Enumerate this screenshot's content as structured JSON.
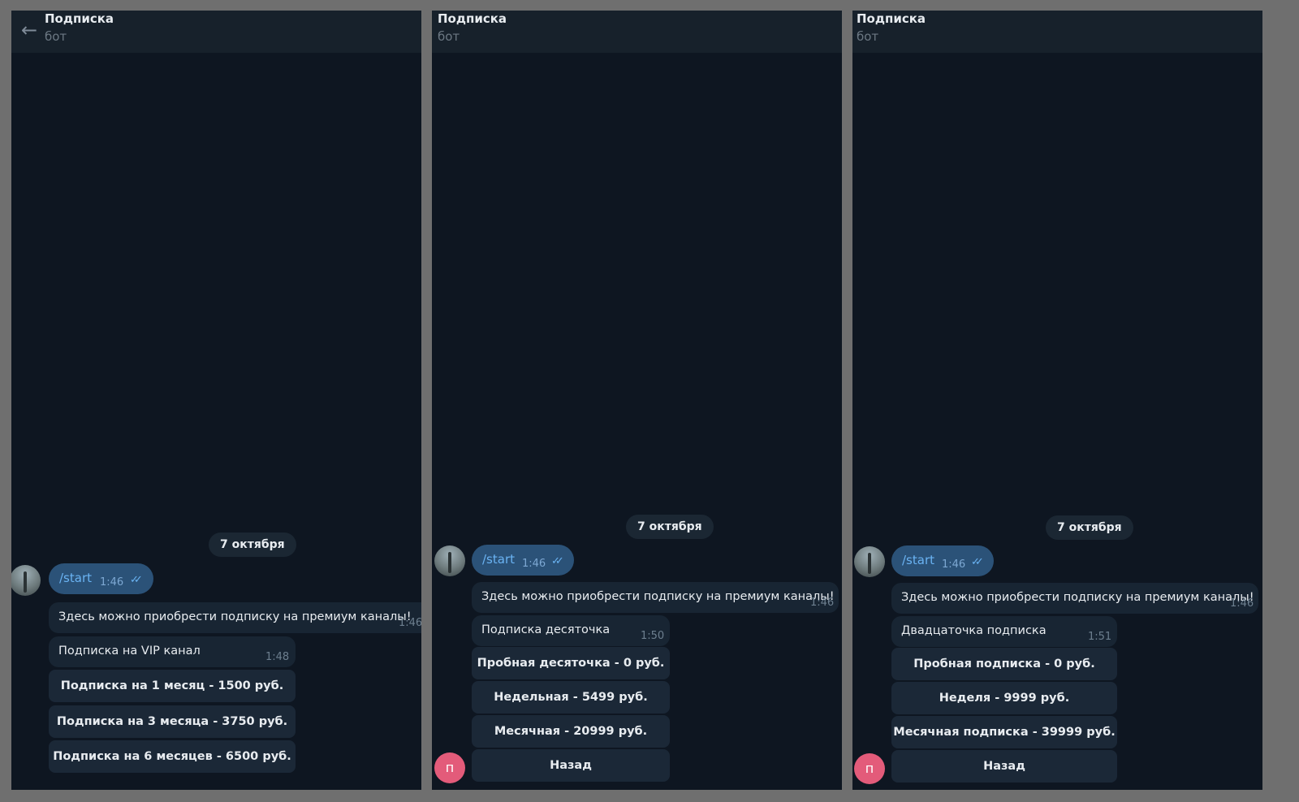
{
  "panels": [
    {
      "header_title": "Подписка",
      "header_subtitle": "бот",
      "date": "7 октября",
      "user_message": {
        "text": "/start",
        "time": "1:46"
      },
      "bot_message": {
        "text": "Здесь можно приобрести подписку на премиум каналы!",
        "time": "1:46"
      },
      "menu_message": {
        "text": "Подписка на VIP канал",
        "time": "1:48"
      },
      "buttons": [
        "Подписка на 1 месяц - 1500 руб.",
        "Подписка на 3 месяца - 3750 руб.",
        "Подписка на 6 месяцев - 6500 руб."
      ]
    },
    {
      "header_title": "Подписка",
      "header_subtitle": "бот",
      "date": "7 октября",
      "user_message": {
        "text": "/start",
        "time": "1:46"
      },
      "bot_message": {
        "text": "Здесь можно приобрести подписку на премиум каналы!",
        "time": "1:46"
      },
      "menu_message": {
        "text": "Подписка десяточка",
        "time": "1:50"
      },
      "buttons": [
        "Пробная десяточка - 0 руб.",
        "Недельная - 5499 руб.",
        "Месячная - 20999 руб.",
        "Назад"
      ],
      "user_avatar_letter": "п"
    },
    {
      "header_title": "Подписка",
      "header_subtitle": "бот",
      "date": "7 октября",
      "user_message": {
        "text": "/start",
        "time": "1:46"
      },
      "bot_message": {
        "text": "Здесь можно приобрести подписку на премиум каналы!",
        "time": "1:46"
      },
      "menu_message": {
        "text": "Двадцаточка подписка",
        "time": "1:51"
      },
      "buttons": [
        "Пробная подписка - 0 руб.",
        "Неделя - 9999 руб.",
        "Месячная подписка - 39999 руб.",
        "Назад"
      ],
      "user_avatar_letter": "п"
    }
  ],
  "icons": {
    "back": "arrow-left-icon",
    "read_checks": "double-check-icon"
  },
  "colors": {
    "chat_bg": "#0e1621",
    "header_bg": "#17212b",
    "outgoing_bubble": "#2b5278",
    "incoming_bubble": "#182533",
    "accent": "#6ab3f3"
  }
}
